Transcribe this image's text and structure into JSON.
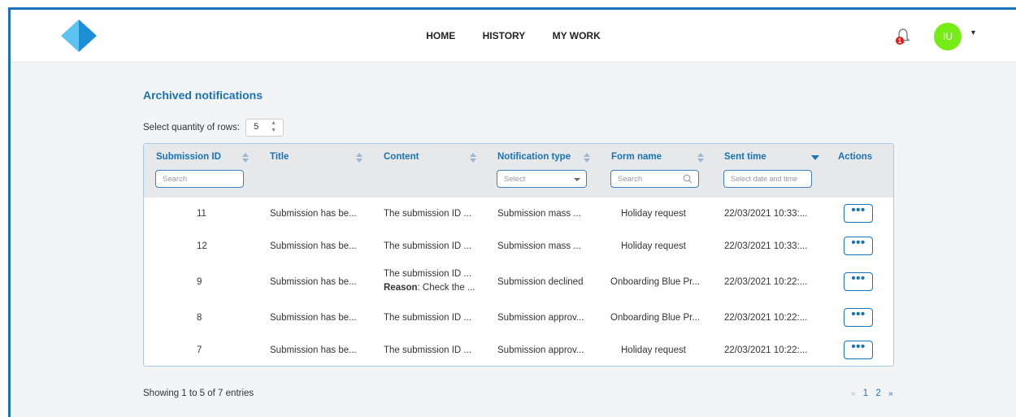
{
  "nav": [
    "HOME",
    "HISTORY",
    "MY WORK"
  ],
  "notifications": {
    "badge_count": "1"
  },
  "user": {
    "initials": "IU"
  },
  "page": {
    "title": "Archived notifications"
  },
  "rows_selector": {
    "label": "Select quantity of rows:",
    "value": "5"
  },
  "columns": [
    "Submission ID",
    "Title",
    "Content",
    "Notification type",
    "Form name",
    "Sent time",
    "Actions"
  ],
  "filters": {
    "submission_id": "Search",
    "notification_type": "Select",
    "form_name": "Search",
    "sent_time": "Select date and time"
  },
  "rows": [
    {
      "id": "11",
      "title": "Submission has be...",
      "content": "The submission ID ...",
      "content_reason_label": "",
      "content_reason": "",
      "type": "Submission mass ...",
      "form": "Holiday request",
      "sent": "22/03/2021 10:33:..."
    },
    {
      "id": "12",
      "title": "Submission has be...",
      "content": "The submission ID ...",
      "content_reason_label": "",
      "content_reason": "",
      "type": "Submission mass ...",
      "form": "Holiday request",
      "sent": "22/03/2021 10:33:..."
    },
    {
      "id": "9",
      "title": "Submission has be...",
      "content": "The submission ID ...",
      "content_reason_label": "Reason",
      "content_reason": ": Check the ...",
      "type": "Submission declined",
      "form": "Onboarding Blue Pr...",
      "sent": "22/03/2021 10:22:..."
    },
    {
      "id": "8",
      "title": "Submission has be...",
      "content": "The submission ID ...",
      "content_reason_label": "",
      "content_reason": "",
      "type": "Submission approv...",
      "form": "Onboarding Blue Pr...",
      "sent": "22/03/2021 10:22:..."
    },
    {
      "id": "7",
      "title": "Submission has be...",
      "content": "The submission ID ...",
      "content_reason_label": "",
      "content_reason": "",
      "type": "Submission approv...",
      "form": "Holiday request",
      "sent": "22/03/2021 10:22:..."
    }
  ],
  "action_label": "•••",
  "footer": {
    "info": "Showing 1 to 5 of 7 entries"
  },
  "pagination": {
    "prev": "«",
    "pages": [
      "1",
      "2"
    ],
    "next": "»"
  },
  "colors": {
    "accent": "#1a73b8",
    "avatar": "#76ec16",
    "badge": "#e21b1b"
  },
  "icons": [
    "logo-icon",
    "bell-icon",
    "chevron-down-icon",
    "sort-icon",
    "sort-desc-icon",
    "search-icon",
    "more-icon"
  ]
}
